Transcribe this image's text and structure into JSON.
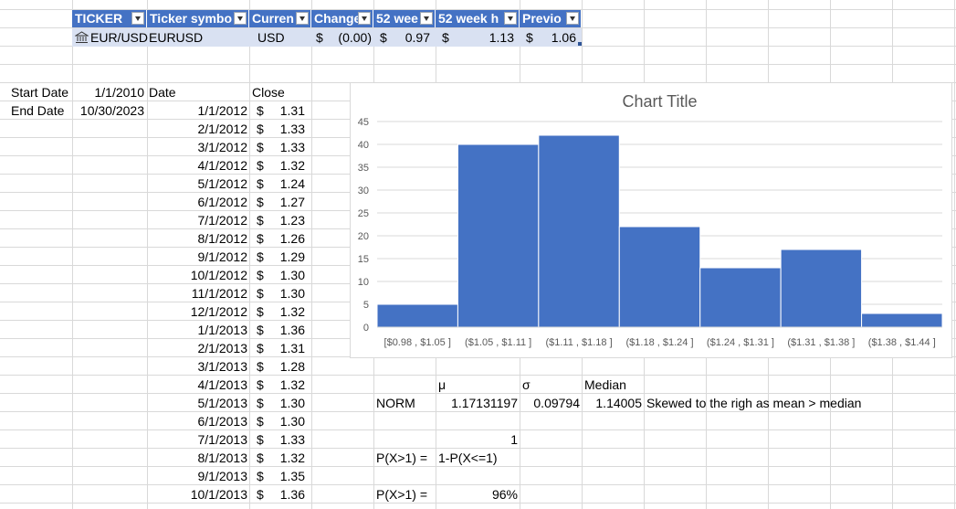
{
  "headers": [
    "TICKER",
    "Ticker symbo",
    "Curren",
    "Change",
    "52 wee",
    "52 week h",
    "Previo"
  ],
  "stock_row": {
    "ticker": "EUR/USD",
    "symbol": "EURUSD",
    "currency": "USD",
    "change_sym": "$",
    "change": "(0.00)",
    "low_sym": "$",
    "low": "0.97",
    "high_sym": "$",
    "high": "1.13",
    "prev_sym": "$",
    "prev": "1.06"
  },
  "labels": {
    "start_date": "Start Date",
    "start_value": "1/1/2010",
    "end_date": "End Date",
    "end_value": "10/30/2023",
    "date_col": "Date",
    "close_col": "Close"
  },
  "rows": [
    {
      "date": "1/1/2012",
      "close": "1.31"
    },
    {
      "date": "2/1/2012",
      "close": "1.33"
    },
    {
      "date": "3/1/2012",
      "close": "1.33"
    },
    {
      "date": "4/1/2012",
      "close": "1.32"
    },
    {
      "date": "5/1/2012",
      "close": "1.24"
    },
    {
      "date": "6/1/2012",
      "close": "1.27"
    },
    {
      "date": "7/1/2012",
      "close": "1.23"
    },
    {
      "date": "8/1/2012",
      "close": "1.26"
    },
    {
      "date": "9/1/2012",
      "close": "1.29"
    },
    {
      "date": "10/1/2012",
      "close": "1.30"
    },
    {
      "date": "11/1/2012",
      "close": "1.30"
    },
    {
      "date": "12/1/2012",
      "close": "1.32"
    },
    {
      "date": "1/1/2013",
      "close": "1.36"
    },
    {
      "date": "2/1/2013",
      "close": "1.31"
    },
    {
      "date": "3/1/2013",
      "close": "1.28"
    },
    {
      "date": "4/1/2013",
      "close": "1.32"
    },
    {
      "date": "5/1/2013",
      "close": "1.30"
    },
    {
      "date": "6/1/2013",
      "close": "1.30"
    },
    {
      "date": "7/1/2013",
      "close": "1.33"
    },
    {
      "date": "8/1/2013",
      "close": "1.32"
    },
    {
      "date": "9/1/2013",
      "close": "1.35"
    },
    {
      "date": "10/1/2013",
      "close": "1.36"
    }
  ],
  "currency_symbol": "$",
  "stats": {
    "mu_label": "μ",
    "sigma_label": "σ",
    "median_label": "Median",
    "norm_label": "NORM",
    "mu": "1.17131197",
    "sigma": "0.09794",
    "median": "1.14005",
    "note": "Skewed to the righ as mean > median",
    "one": "1",
    "p_label": "P(X>1) =",
    "p_formula": "1-P(X<=1)",
    "p_label2": "P(X>1) =",
    "p_value": "96%"
  },
  "colors": {
    "header_bg": "#4472c4",
    "row_bg": "#d9e1f2",
    "bar": "#4472c4",
    "grid": "#d9d9d9"
  },
  "chart_data": {
    "type": "bar",
    "title": "Chart Title",
    "categories": [
      "[$0.98 , $1.05 ]",
      "($1.05 , $1.11 ]",
      "($1.11 , $1.18 ]",
      "($1.18 , $1.24 ]",
      "($1.24 , $1.31 ]",
      "($1.31 , $1.38 ]",
      "($1.38 , $1.44 ]"
    ],
    "values": [
      5,
      40,
      42,
      22,
      13,
      17,
      3
    ],
    "ylim": [
      0,
      45
    ],
    "yticks": [
      0,
      5,
      10,
      15,
      20,
      25,
      30,
      35,
      40,
      45
    ],
    "grid": true,
    "legend": "none"
  }
}
